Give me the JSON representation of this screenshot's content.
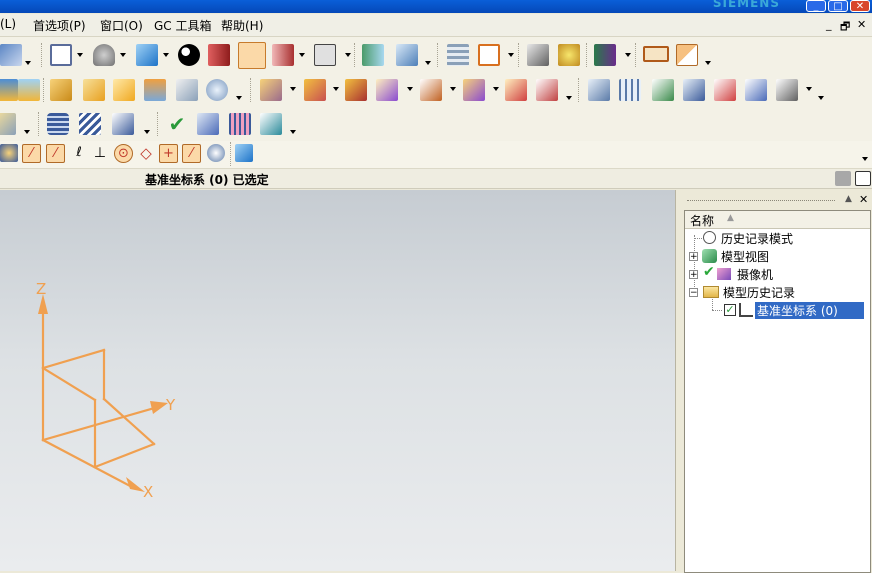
{
  "window": {
    "brand": "SIEMENS",
    "min": "_",
    "max": "□",
    "close": "✕"
  },
  "menubar": {
    "items": [
      "(L)",
      "首选项(P)",
      "窗口(O)",
      "GC 工具箱",
      "帮助(H)"
    ],
    "mdi_min": "_",
    "mdi_restore": "🗗",
    "mdi_close": "✕"
  },
  "status": {
    "text": "基准坐标系 (0)  已选定"
  },
  "viewport": {
    "axis_x": "X",
    "axis_y": "Y",
    "axis_z": "Z",
    "triad_color": "#f0a050"
  },
  "navigator": {
    "column_name": "名称",
    "sort_indicator": "▲",
    "pin": "▲",
    "close": "✕",
    "tree": [
      {
        "label": "历史记录模式",
        "icon": "clock-icon",
        "expander": ""
      },
      {
        "label": "模型视图",
        "icon": "model-views-icon",
        "expander": "+"
      },
      {
        "label": "摄像机",
        "icon": "camera-icon",
        "expander": "+"
      },
      {
        "label": "模型历史记录",
        "icon": "folder-icon",
        "expander": "−"
      },
      {
        "label": "基准坐标系  (0)",
        "icon": "datum-csys-icon",
        "expander": "",
        "selected": true
      }
    ]
  }
}
